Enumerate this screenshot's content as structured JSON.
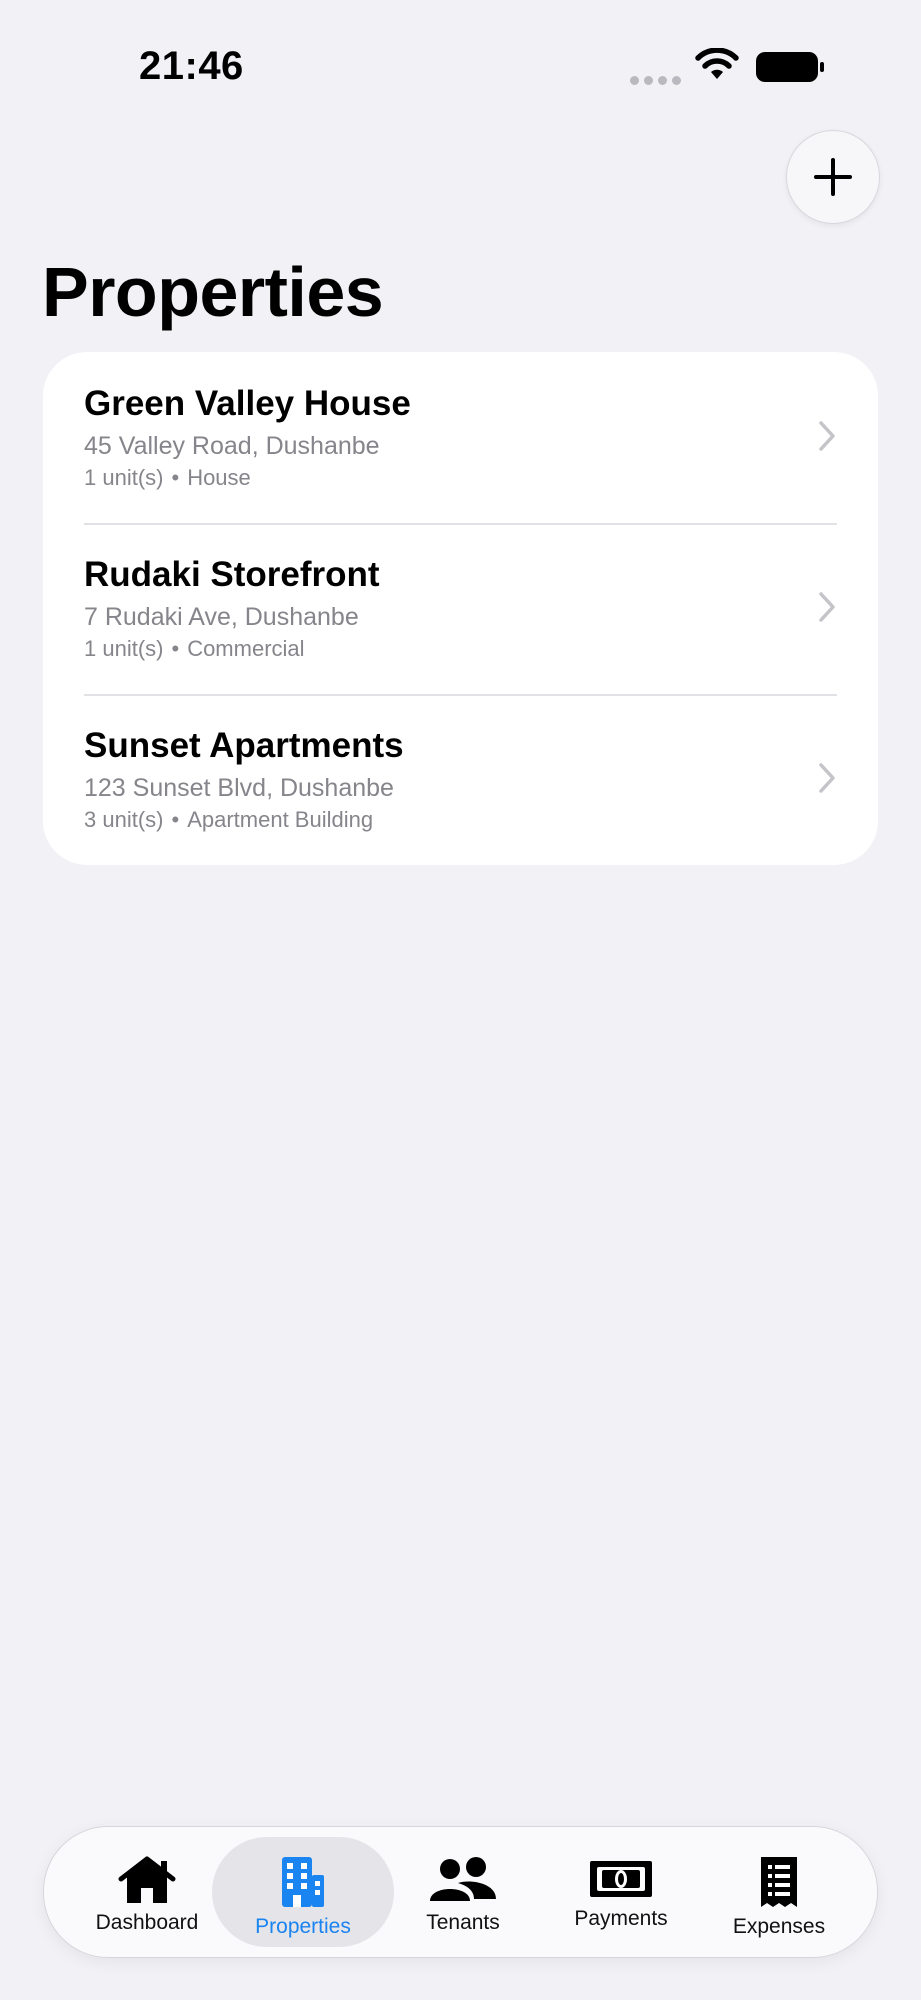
{
  "status_bar": {
    "time": "21:46"
  },
  "header": {
    "title": "Properties",
    "add_icon": "plus-icon"
  },
  "properties": [
    {
      "name": "Green Valley House",
      "address": "45 Valley Road, Dushanbe",
      "units": "1 unit(s)",
      "separator": "•",
      "type": "House"
    },
    {
      "name": "Rudaki Storefront",
      "address": "7 Rudaki Ave, Dushanbe",
      "units": "1 unit(s)",
      "separator": "•",
      "type": "Commercial"
    },
    {
      "name": "Sunset Apartments",
      "address": "123 Sunset Blvd, Dushanbe",
      "units": "3 unit(s)",
      "separator": "•",
      "type": "Apartment Building"
    }
  ],
  "tab_bar": {
    "active_color": "#1a84f0",
    "tabs": [
      {
        "label": "Dashboard",
        "icon": "house-icon"
      },
      {
        "label": "Properties",
        "icon": "building-icon",
        "active": true
      },
      {
        "label": "Tenants",
        "icon": "people-icon"
      },
      {
        "label": "Payments",
        "icon": "banknote-icon"
      },
      {
        "label": "Expenses",
        "icon": "receipt-icon"
      }
    ]
  }
}
